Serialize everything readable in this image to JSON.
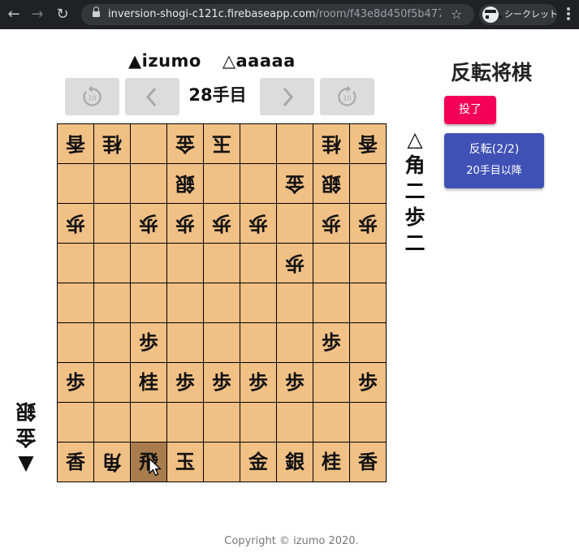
{
  "browser": {
    "url_host": "inversion-shogi-c121c.firebaseapp.com",
    "url_path": "/room/f43e8d450f5b477...",
    "incognito_label": "シークレット"
  },
  "players": {
    "sente": "▲izumo",
    "gote": "△aaaaa"
  },
  "controls": {
    "move_label": "28手目",
    "skip_back_count": "10",
    "skip_forward_count": "10"
  },
  "board": {
    "rows": [
      [
        {
          "p": "香",
          "g": true
        },
        {
          "p": "桂",
          "g": true
        },
        {
          "p": ""
        },
        {
          "p": "金",
          "g": true
        },
        {
          "p": "玉",
          "g": true
        },
        {
          "p": ""
        },
        {
          "p": ""
        },
        {
          "p": "桂",
          "g": true
        },
        {
          "p": "香",
          "g": true
        }
      ],
      [
        {
          "p": ""
        },
        {
          "p": ""
        },
        {
          "p": ""
        },
        {
          "p": "銀",
          "g": true
        },
        {
          "p": ""
        },
        {
          "p": ""
        },
        {
          "p": "金",
          "g": true
        },
        {
          "p": "銀",
          "g": true
        },
        {
          "p": ""
        }
      ],
      [
        {
          "p": "歩",
          "g": true
        },
        {
          "p": ""
        },
        {
          "p": "歩",
          "g": true
        },
        {
          "p": "歩",
          "g": true
        },
        {
          "p": "歩",
          "g": true
        },
        {
          "p": "歩",
          "g": true
        },
        {
          "p": ""
        },
        {
          "p": "歩",
          "g": true
        },
        {
          "p": "歩",
          "g": true
        }
      ],
      [
        {
          "p": ""
        },
        {
          "p": ""
        },
        {
          "p": ""
        },
        {
          "p": ""
        },
        {
          "p": ""
        },
        {
          "p": ""
        },
        {
          "p": "歩",
          "g": true
        },
        {
          "p": ""
        },
        {
          "p": ""
        }
      ],
      [
        {
          "p": ""
        },
        {
          "p": ""
        },
        {
          "p": ""
        },
        {
          "p": ""
        },
        {
          "p": ""
        },
        {
          "p": ""
        },
        {
          "p": ""
        },
        {
          "p": ""
        },
        {
          "p": ""
        }
      ],
      [
        {
          "p": ""
        },
        {
          "p": ""
        },
        {
          "p": "歩"
        },
        {
          "p": ""
        },
        {
          "p": ""
        },
        {
          "p": ""
        },
        {
          "p": ""
        },
        {
          "p": "歩"
        },
        {
          "p": ""
        }
      ],
      [
        {
          "p": "歩"
        },
        {
          "p": ""
        },
        {
          "p": "桂"
        },
        {
          "p": "歩"
        },
        {
          "p": "歩"
        },
        {
          "p": "歩"
        },
        {
          "p": "歩"
        },
        {
          "p": ""
        },
        {
          "p": "歩"
        }
      ],
      [
        {
          "p": ""
        },
        {
          "p": ""
        },
        {
          "p": ""
        },
        {
          "p": ""
        },
        {
          "p": ""
        },
        {
          "p": ""
        },
        {
          "p": ""
        },
        {
          "p": ""
        },
        {
          "p": ""
        }
      ],
      [
        {
          "p": "香"
        },
        {
          "p": "角",
          "g": true
        },
        {
          "p": "飛",
          "hl": true
        },
        {
          "p": "玉"
        },
        {
          "p": ""
        },
        {
          "p": "金"
        },
        {
          "p": "銀"
        },
        {
          "p": "桂"
        },
        {
          "p": "香"
        }
      ]
    ]
  },
  "hands": {
    "gote": {
      "mark": "△",
      "pieces": [
        "角",
        "二",
        "歩",
        "二"
      ]
    },
    "sente": {
      "mark": "▼",
      "pieces": [
        "銀",
        "金"
      ]
    }
  },
  "sidebar": {
    "title": "反転将棋",
    "resign_label": "投了",
    "invert_label": "反転(2/2)",
    "invert_sub": "20手目以降"
  },
  "footer": {
    "copyright": "Copyright © izumo 2020."
  },
  "colors": {
    "board": "#f1c084",
    "highlight": "#a97c4e",
    "resign": "#f50057",
    "invert": "#3f51b5"
  }
}
